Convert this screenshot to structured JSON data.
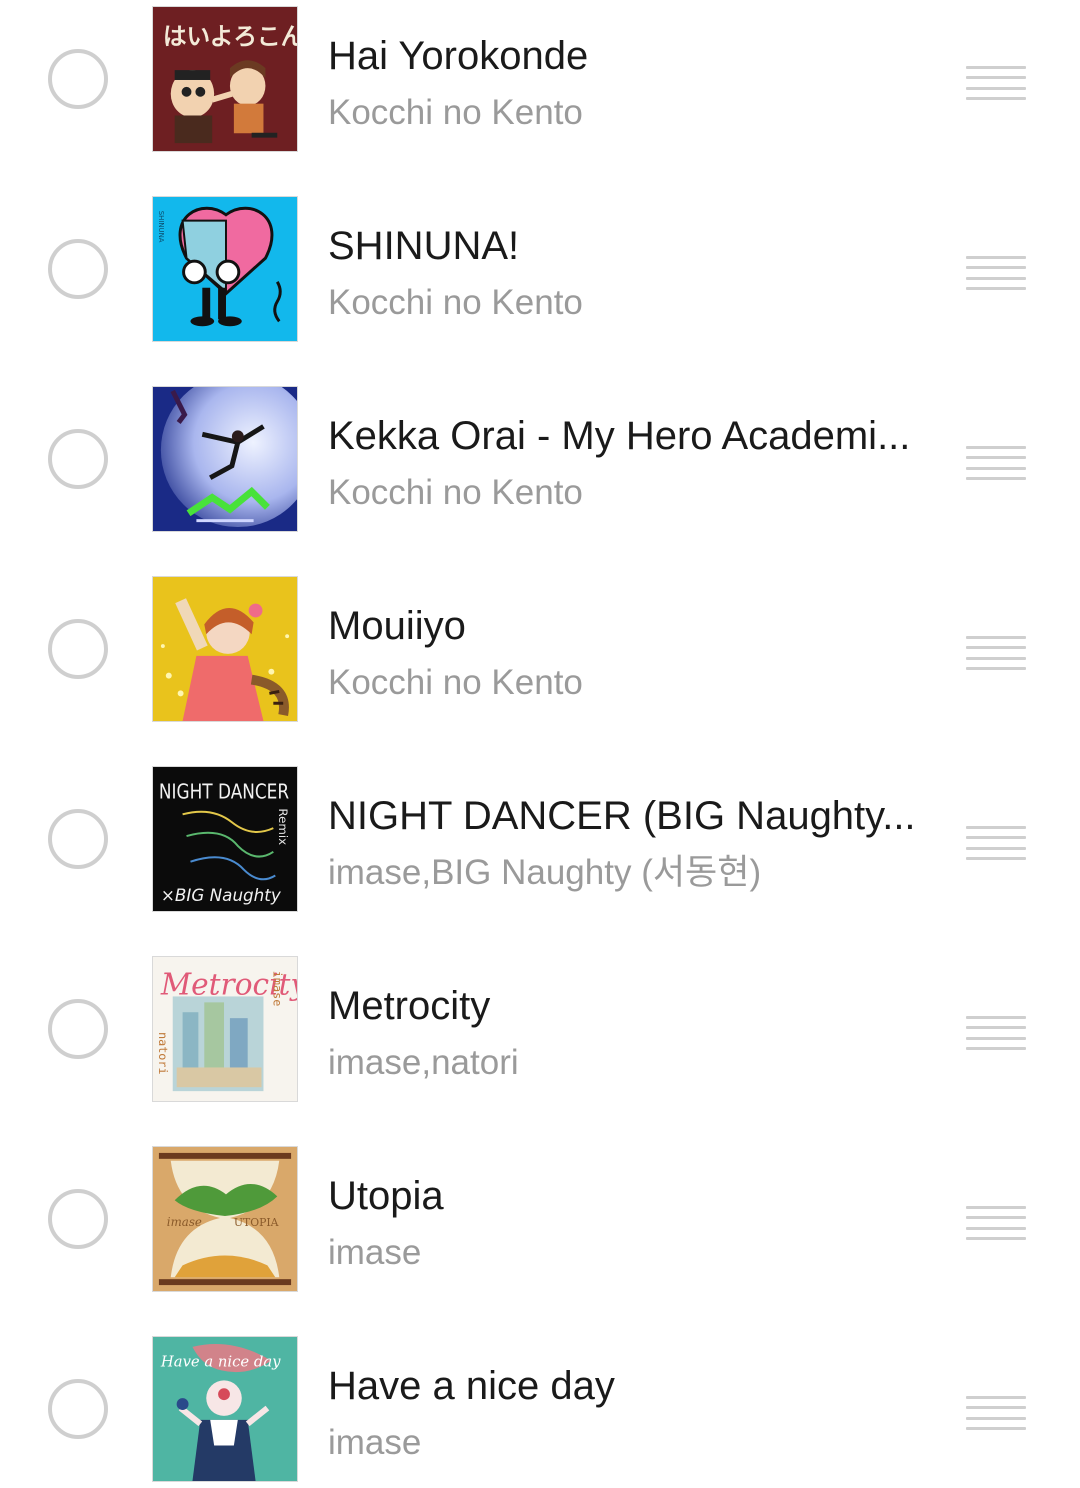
{
  "songs": [
    {
      "title": "Hai Yorokonde",
      "artist": "Kocchi no Kento",
      "cover_text": "はいよろこんで"
    },
    {
      "title": "SHINUNA!",
      "artist": "Kocchi no Kento",
      "cover_text": "SHINUNA"
    },
    {
      "title": "Kekka Orai - My Hero Academi...",
      "artist": "Kocchi no Kento",
      "cover_text": ""
    },
    {
      "title": "Mouiiyo",
      "artist": "Kocchi no Kento",
      "cover_text": ""
    },
    {
      "title": "NIGHT DANCER (BIG Naughty...",
      "artist": "imase,BIG Naughty (서동현)",
      "cover_text": "NIGHT DANCER",
      "cover_text2": "Remix",
      "cover_text3": "×BIG Naughty"
    },
    {
      "title": "Metrocity",
      "artist": "imase,natori",
      "cover_text": "Metrocity",
      "cover_text2": "imase",
      "cover_text3": "natori"
    },
    {
      "title": "Utopia",
      "artist": "imase",
      "cover_text": "imase",
      "cover_text2": "UTOPIA"
    },
    {
      "title": "Have a nice day",
      "artist": "imase",
      "cover_text": "Have a nice day"
    }
  ]
}
